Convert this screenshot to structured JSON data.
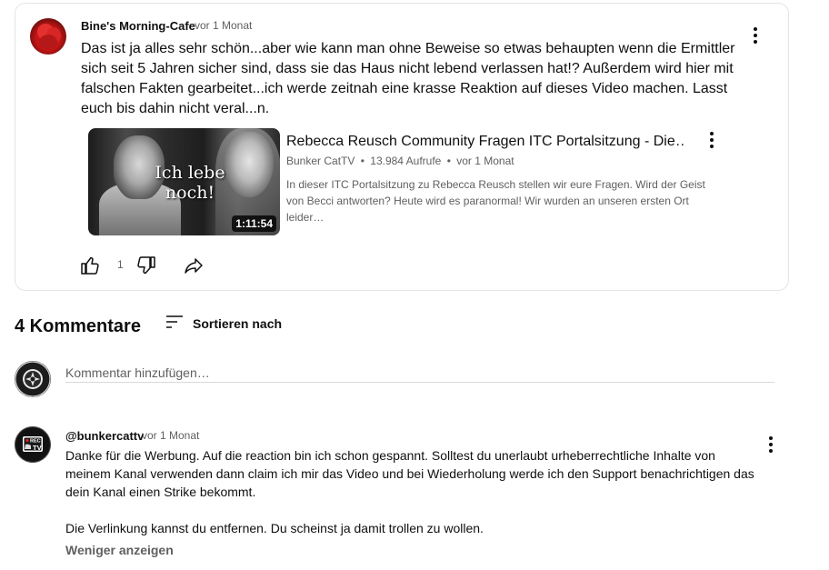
{
  "top_comment": {
    "author": "Bine's Morning-Cafe",
    "time": "vor 1 Monat",
    "text": "Das ist ja alles sehr schön...aber wie kann man ohne Beweise so etwas behaupten wenn die Ermittler sich seit 5 Jahren sicher sind, dass sie das Haus nicht lebend verlassen hat!? Außerdem wird hier mit falschen Fakten gearbeitet...ich werde zeitnah eine krasse Reaktion auf dieses Video machen. Lasst euch bis dahin nicht veral...n.",
    "likes": "1",
    "video": {
      "thumbnail_text": "Ich lebe noch!",
      "duration": "1:11:54",
      "title": "Rebecca Reusch Community Fragen ITC Portalsitzung - Die…",
      "channel": "Bunker CatTV",
      "separator": "•",
      "views": "13.984 Aufrufe",
      "time": "vor 1 Monat",
      "description": "In dieser ITC Portalsitzung zu Rebecca Reusch stellen wir eure Fragen. Wird der Geist von Becci antworten? Heute wird es paranormal! Wir wurden an unseren ersten Ort leider…"
    }
  },
  "comments_header": {
    "count_label": "4 Kommentare",
    "sort_label": "Sortieren nach"
  },
  "add_comment": {
    "placeholder": "Kommentar hinzufügen…"
  },
  "reply": {
    "author": "@bunkercattv",
    "time": "vor 1 Monat",
    "paragraph1": "Danke für die Werbung. Auf die reaction bin ich schon gespannt. Solltest du unerlaubt urheberrechtliche Inhalte von meinem Kanal verwenden dann claim ich mir das Video und bei Wiederholung werde ich den Support benachrichtigen das dein Kanal einen Strike bekommt.",
    "paragraph2": "Die Verlinkung kannst du entfernen. Du scheinst ja damit trollen zu wollen.",
    "show_less": "Weniger anzeigen",
    "avatar_badge": "REC",
    "avatar_label": "TV"
  },
  "icons": {
    "like": "thumb-up-icon",
    "dislike": "thumb-down-icon",
    "share": "share-icon",
    "sort": "sort-icon",
    "menu": "more-vert-icon"
  }
}
